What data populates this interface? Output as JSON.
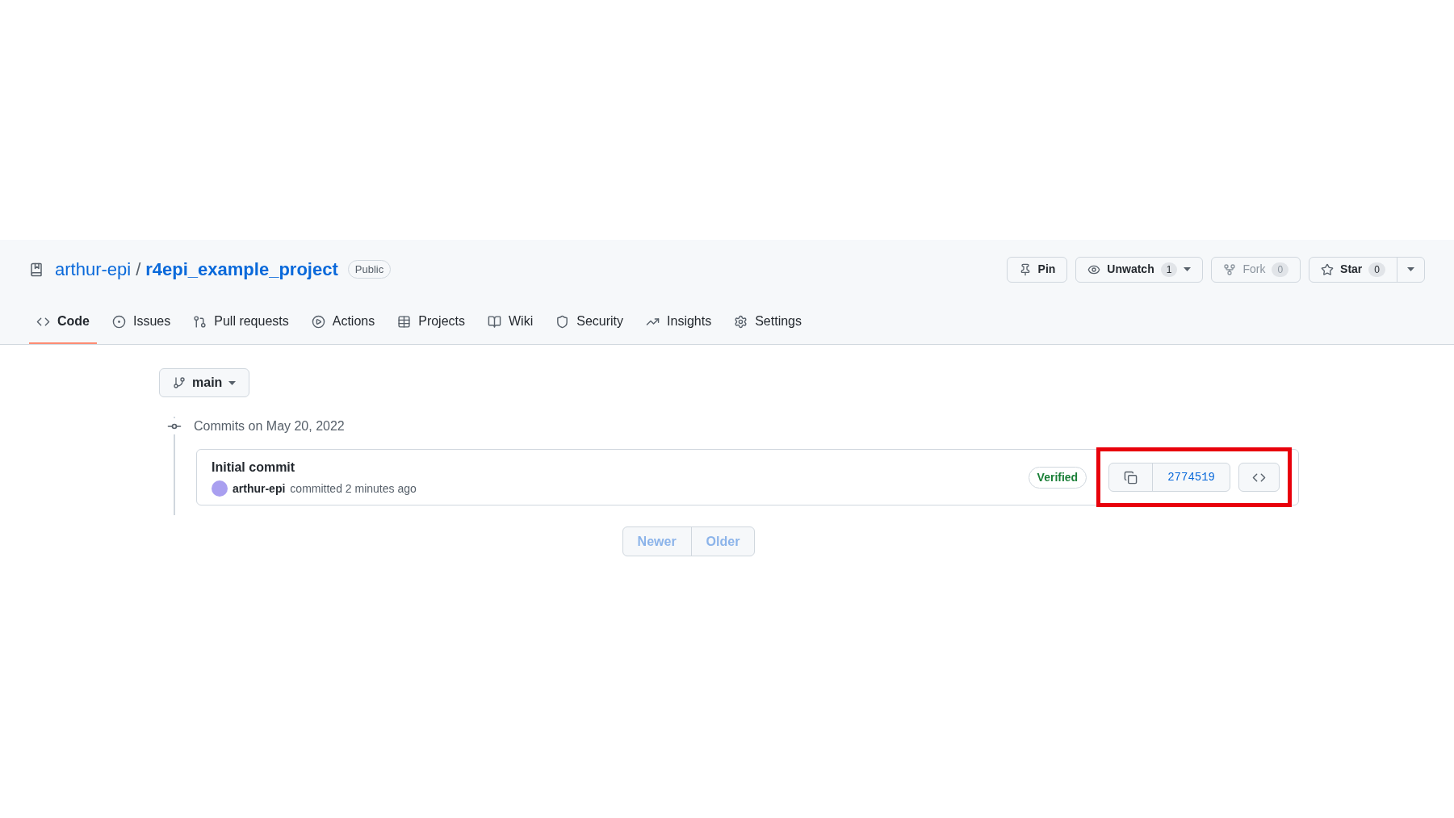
{
  "repo": {
    "owner": "arthur-epi",
    "separator": "/",
    "name": "r4epi_example_project",
    "visibility": "Public"
  },
  "actions": [
    {
      "kind": "pin",
      "label": "Pin",
      "disabled": false,
      "dropdown": false
    },
    {
      "kind": "watch",
      "label": "Unwatch",
      "count": "1",
      "disabled": false,
      "dropdown": true
    },
    {
      "kind": "fork",
      "label": "Fork",
      "count": "0",
      "disabled": true,
      "dropdown": false
    },
    {
      "kind": "star",
      "label": "Star",
      "count": "0",
      "disabled": false,
      "dropdown": true
    }
  ],
  "tabs": [
    {
      "kind": "code",
      "label": "Code",
      "selected": true
    },
    {
      "kind": "issues",
      "label": "Issues",
      "selected": false
    },
    {
      "kind": "pulls",
      "label": "Pull requests",
      "selected": false
    },
    {
      "kind": "actions",
      "label": "Actions",
      "selected": false
    },
    {
      "kind": "projects",
      "label": "Projects",
      "selected": false
    },
    {
      "kind": "wiki",
      "label": "Wiki",
      "selected": false
    },
    {
      "kind": "security",
      "label": "Security",
      "selected": false
    },
    {
      "kind": "insights",
      "label": "Insights",
      "selected": false
    },
    {
      "kind": "settings",
      "label": "Settings",
      "selected": false
    }
  ],
  "branch": "main",
  "commit_groups": [
    {
      "heading": "Commits on May 20, 2022",
      "commits": [
        {
          "title": "Initial commit",
          "author": "arthur-epi",
          "meta": "committed 2 minutes ago",
          "badge": "Verified",
          "sha": "2774519",
          "highlighted": true
        }
      ]
    }
  ],
  "pagination": [
    {
      "label": "Newer",
      "disabled": true
    },
    {
      "label": "Older",
      "disabled": true
    }
  ]
}
